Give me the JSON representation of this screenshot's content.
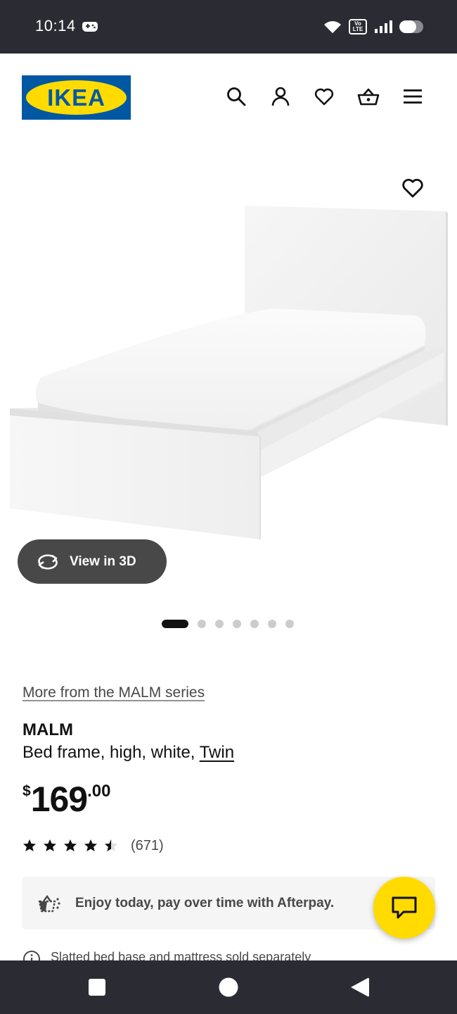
{
  "status_bar": {
    "time": "10:14",
    "volte_label": "Vo LTE",
    "battery_level": 0.7,
    "icons": [
      "game-controller-icon",
      "wifi-icon",
      "volte-icon",
      "signal-icon",
      "battery-icon"
    ]
  },
  "header": {
    "logo_text": "IKEA",
    "logo_registered": "®",
    "icons": [
      "search-icon",
      "account-icon",
      "heart-icon",
      "basket-icon",
      "menu-icon"
    ]
  },
  "product": {
    "view_in_3d": "View in 3D",
    "carousel": {
      "total": 7,
      "active_index": 0
    },
    "series_link": "More from the MALM series",
    "name": "MALM",
    "description_prefix": "Bed frame, high, white, ",
    "size_link": "Twin",
    "price": {
      "currency": "$",
      "integer": "169",
      "decimal": ".00"
    },
    "rating": {
      "stars": 4.5,
      "max": 5,
      "count": "(671)"
    },
    "afterpay_text": "Enjoy today, pay over time with Afterpay.",
    "note_text": "Slatted bed base and mattress sold separately"
  },
  "colors": {
    "ikea_blue": "#0058a3",
    "ikea_yellow": "#ffdb00",
    "system_bar": "#2b2b33",
    "pill_bg": "#484848"
  },
  "nav_bar": {
    "icons": [
      "recents-square-icon",
      "home-circle-icon",
      "back-triangle-icon"
    ]
  }
}
